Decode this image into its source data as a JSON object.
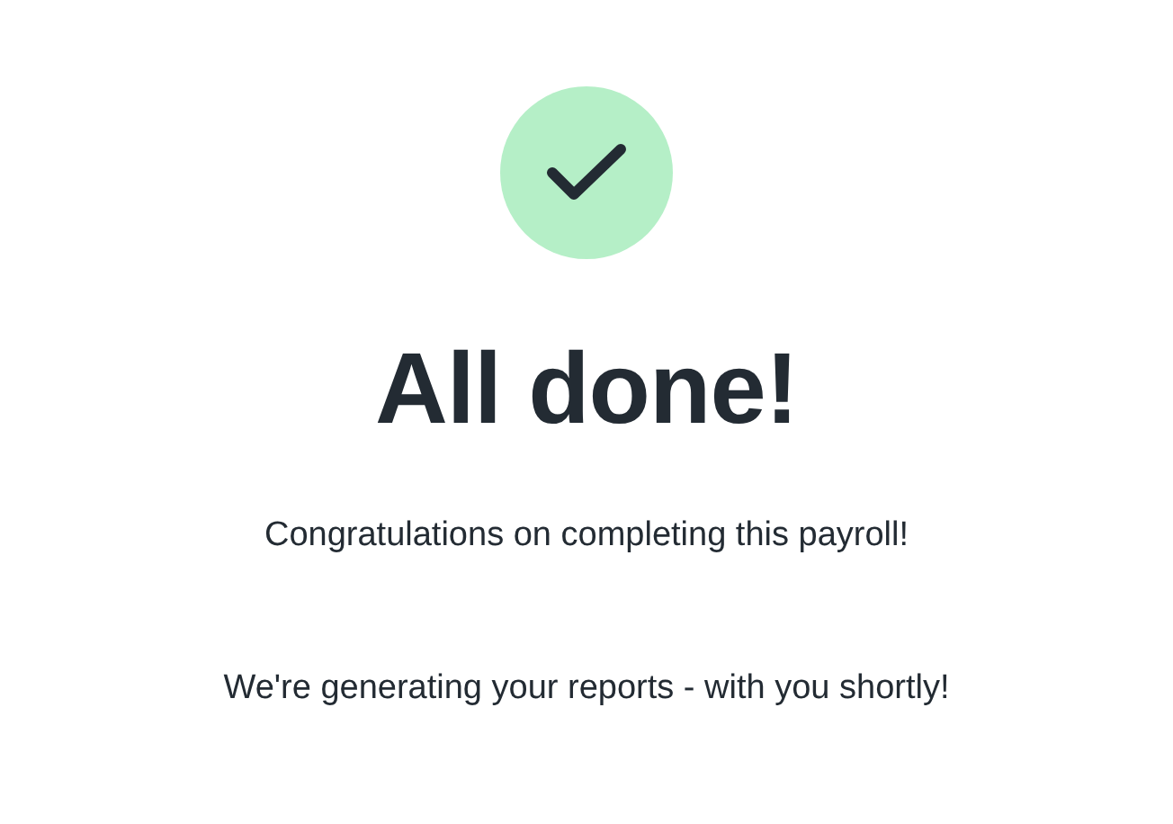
{
  "title": "All done!",
  "messages": [
    "Congratulations on completing this payroll!",
    "We're generating your reports - with you shortly!"
  ]
}
